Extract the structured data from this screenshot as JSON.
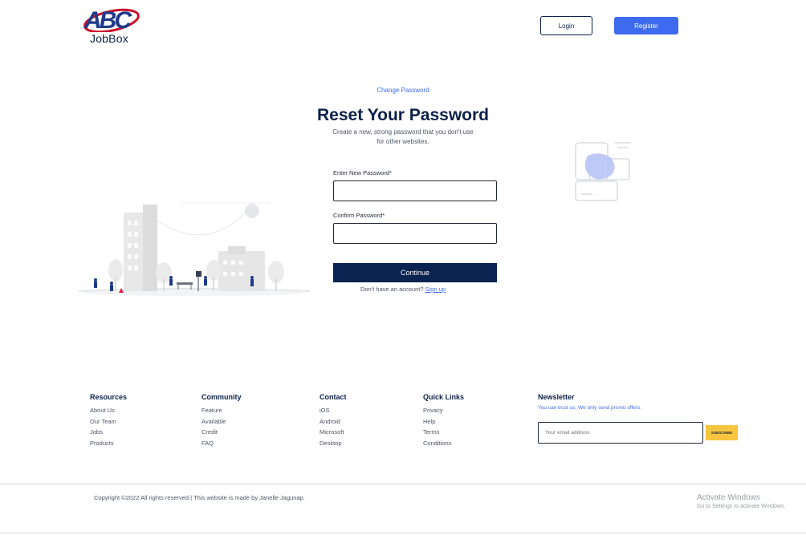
{
  "header": {
    "logo_letters": "ABC",
    "logo_text": "JobBox",
    "login_label": "Login",
    "register_label": "Register",
    "brand_colors": {
      "navy": "#0b1f4a",
      "red": "#c8102e",
      "blue": "#3d6aee"
    }
  },
  "form": {
    "eyebrow": "Change Password",
    "title": "Reset Your Password",
    "subtitle": "Create a new, strong password that you don't use for other websites.",
    "new_password_label": "Enter New Password*",
    "new_password_value": "",
    "confirm_password_label": "Confirm Password*",
    "confirm_password_value": "",
    "continue_label": "Continue",
    "no_account_text": "Don't have an account?",
    "signup_label": "Sign up"
  },
  "footer": {
    "resources": {
      "heading": "Resources",
      "links": [
        "About Us",
        "Our Team",
        "Jobs",
        "Products"
      ]
    },
    "community": {
      "heading": "Community",
      "links": [
        "Feature",
        "Available",
        "Credit",
        "FAQ"
      ]
    },
    "contact": {
      "heading": "Contact",
      "links": [
        "iOS",
        "Android",
        "Microsoft",
        "Desktop"
      ]
    },
    "quick_links": {
      "heading": "Quick Links",
      "links": [
        "Privacy",
        "Help",
        "Terms",
        "Conditions"
      ]
    },
    "newsletter": {
      "heading": "Newsletter",
      "note": "You can trust us, We only send promo offers.",
      "email_placeholder": "Your email address",
      "subscribe_label": "SUBSCRIBE"
    },
    "copyright": "Copyright ©2022 All rights reserved | This website is made by Janelle Jagunap."
  },
  "watermark": {
    "title": "Activate Windows",
    "subtitle": "Go to Settings to activate Windows."
  },
  "illustrations": {
    "left": "city-park-illustration",
    "right": "cards-illustration"
  }
}
